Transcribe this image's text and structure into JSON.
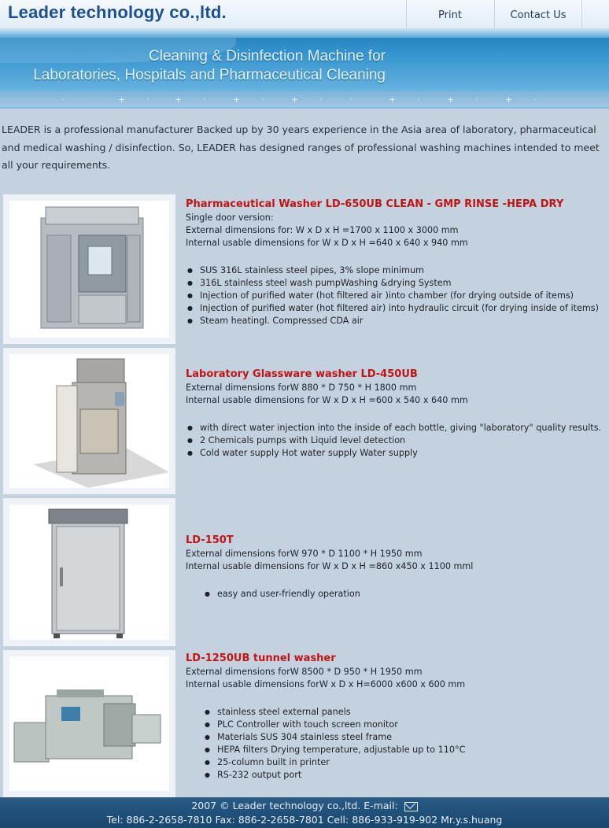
{
  "header": {
    "logo": "Leader technology co.,ltd.",
    "nav": {
      "print": "Print",
      "contact": "Contact Us"
    },
    "tagline": [
      "Cleaning & Disinfection Machine for",
      "Laboratories, Hospitals and Pharmaceutical Cleaning"
    ]
  },
  "intro": "LEADER is a professional manufacturer Backed up by 30 years experience in the Asia area of laboratory, pharmaceutical and medical washing / disinfection. So, LEADER has designed ranges of professional washing machines intended to meet all your requirements.",
  "products": [
    {
      "title": "Pharmaceutical Washer LD-650UB CLEAN - GMP RINSE -HEPA DRY",
      "lines": [
        "Single door version:",
        "External dimensions for: W x D x H =1700 x 1100 x 3000 mm",
        "Internal usable dimensions for W x D x H =640 x 640 x 940 mm"
      ],
      "bullets": [
        "SUS 316L stainless steel pipes, 3% slope minimum",
        "316L stainless steel wash pumpWashing &drying System",
        "Injection of purified water (hot filtered air )into chamber (for drying outside of items)",
        "Injection of purified water (hot filtered air) into hydraulic circuit (for drying inside of items)",
        "Steam heatingl. Compressed CDA air"
      ],
      "image_icon": "cabinet-washer-image"
    },
    {
      "title": "Laboratory Glassware washer LD-450UB",
      "lines": [
        "External dimensions forW 880 * D 750 * H 1800 mm",
        "Internal usable dimensions for W x D x H =600 x 540 x 640 mm"
      ],
      "bullets": [
        "with direct water injection into the inside of each bottle, giving \"laboratory\" quality results.",
        "2 Chemicals pumps with Liquid level detection",
        "Cold water supply Hot water supply Water supply"
      ],
      "image_icon": "glassware-washer-image"
    },
    {
      "title": "LD-150T",
      "lines": [
        "External dimensions forW 970 * D 1100 * H 1950 mm",
        "Internal usable dimensions for W x D x H =860 x450 x 1100 mml"
      ],
      "bullets": [
        "easy and user-friendly operation"
      ],
      "image_icon": "washer-cabinet-image"
    },
    {
      "title": "LD-1250UB tunnel washer",
      "lines": [
        "External dimensions forW 8500 * D 950 * H 1950 mm",
        "Internal usable dimensions forW x D x H=6000 x600 x 600 mm"
      ],
      "bullets": [
        "stainless steel external panels",
        "PLC Controller with touch screen monitor",
        "Materials SUS 304 stainless steel frame",
        "HEPA filters Drying temperature, adjustable up to 110°C",
        "25-column built in printer",
        "RS-232 output port"
      ],
      "image_icon": "tunnel-washer-image"
    }
  ],
  "footer": {
    "line1": "2007 © Leader technology co.,ltd. E-mail:",
    "line2": "Tel: 886-2-2658-7810 Fax: 886-2-2658-7801 Cell: 886-933-919-902 Mr.y.s.huang"
  }
}
